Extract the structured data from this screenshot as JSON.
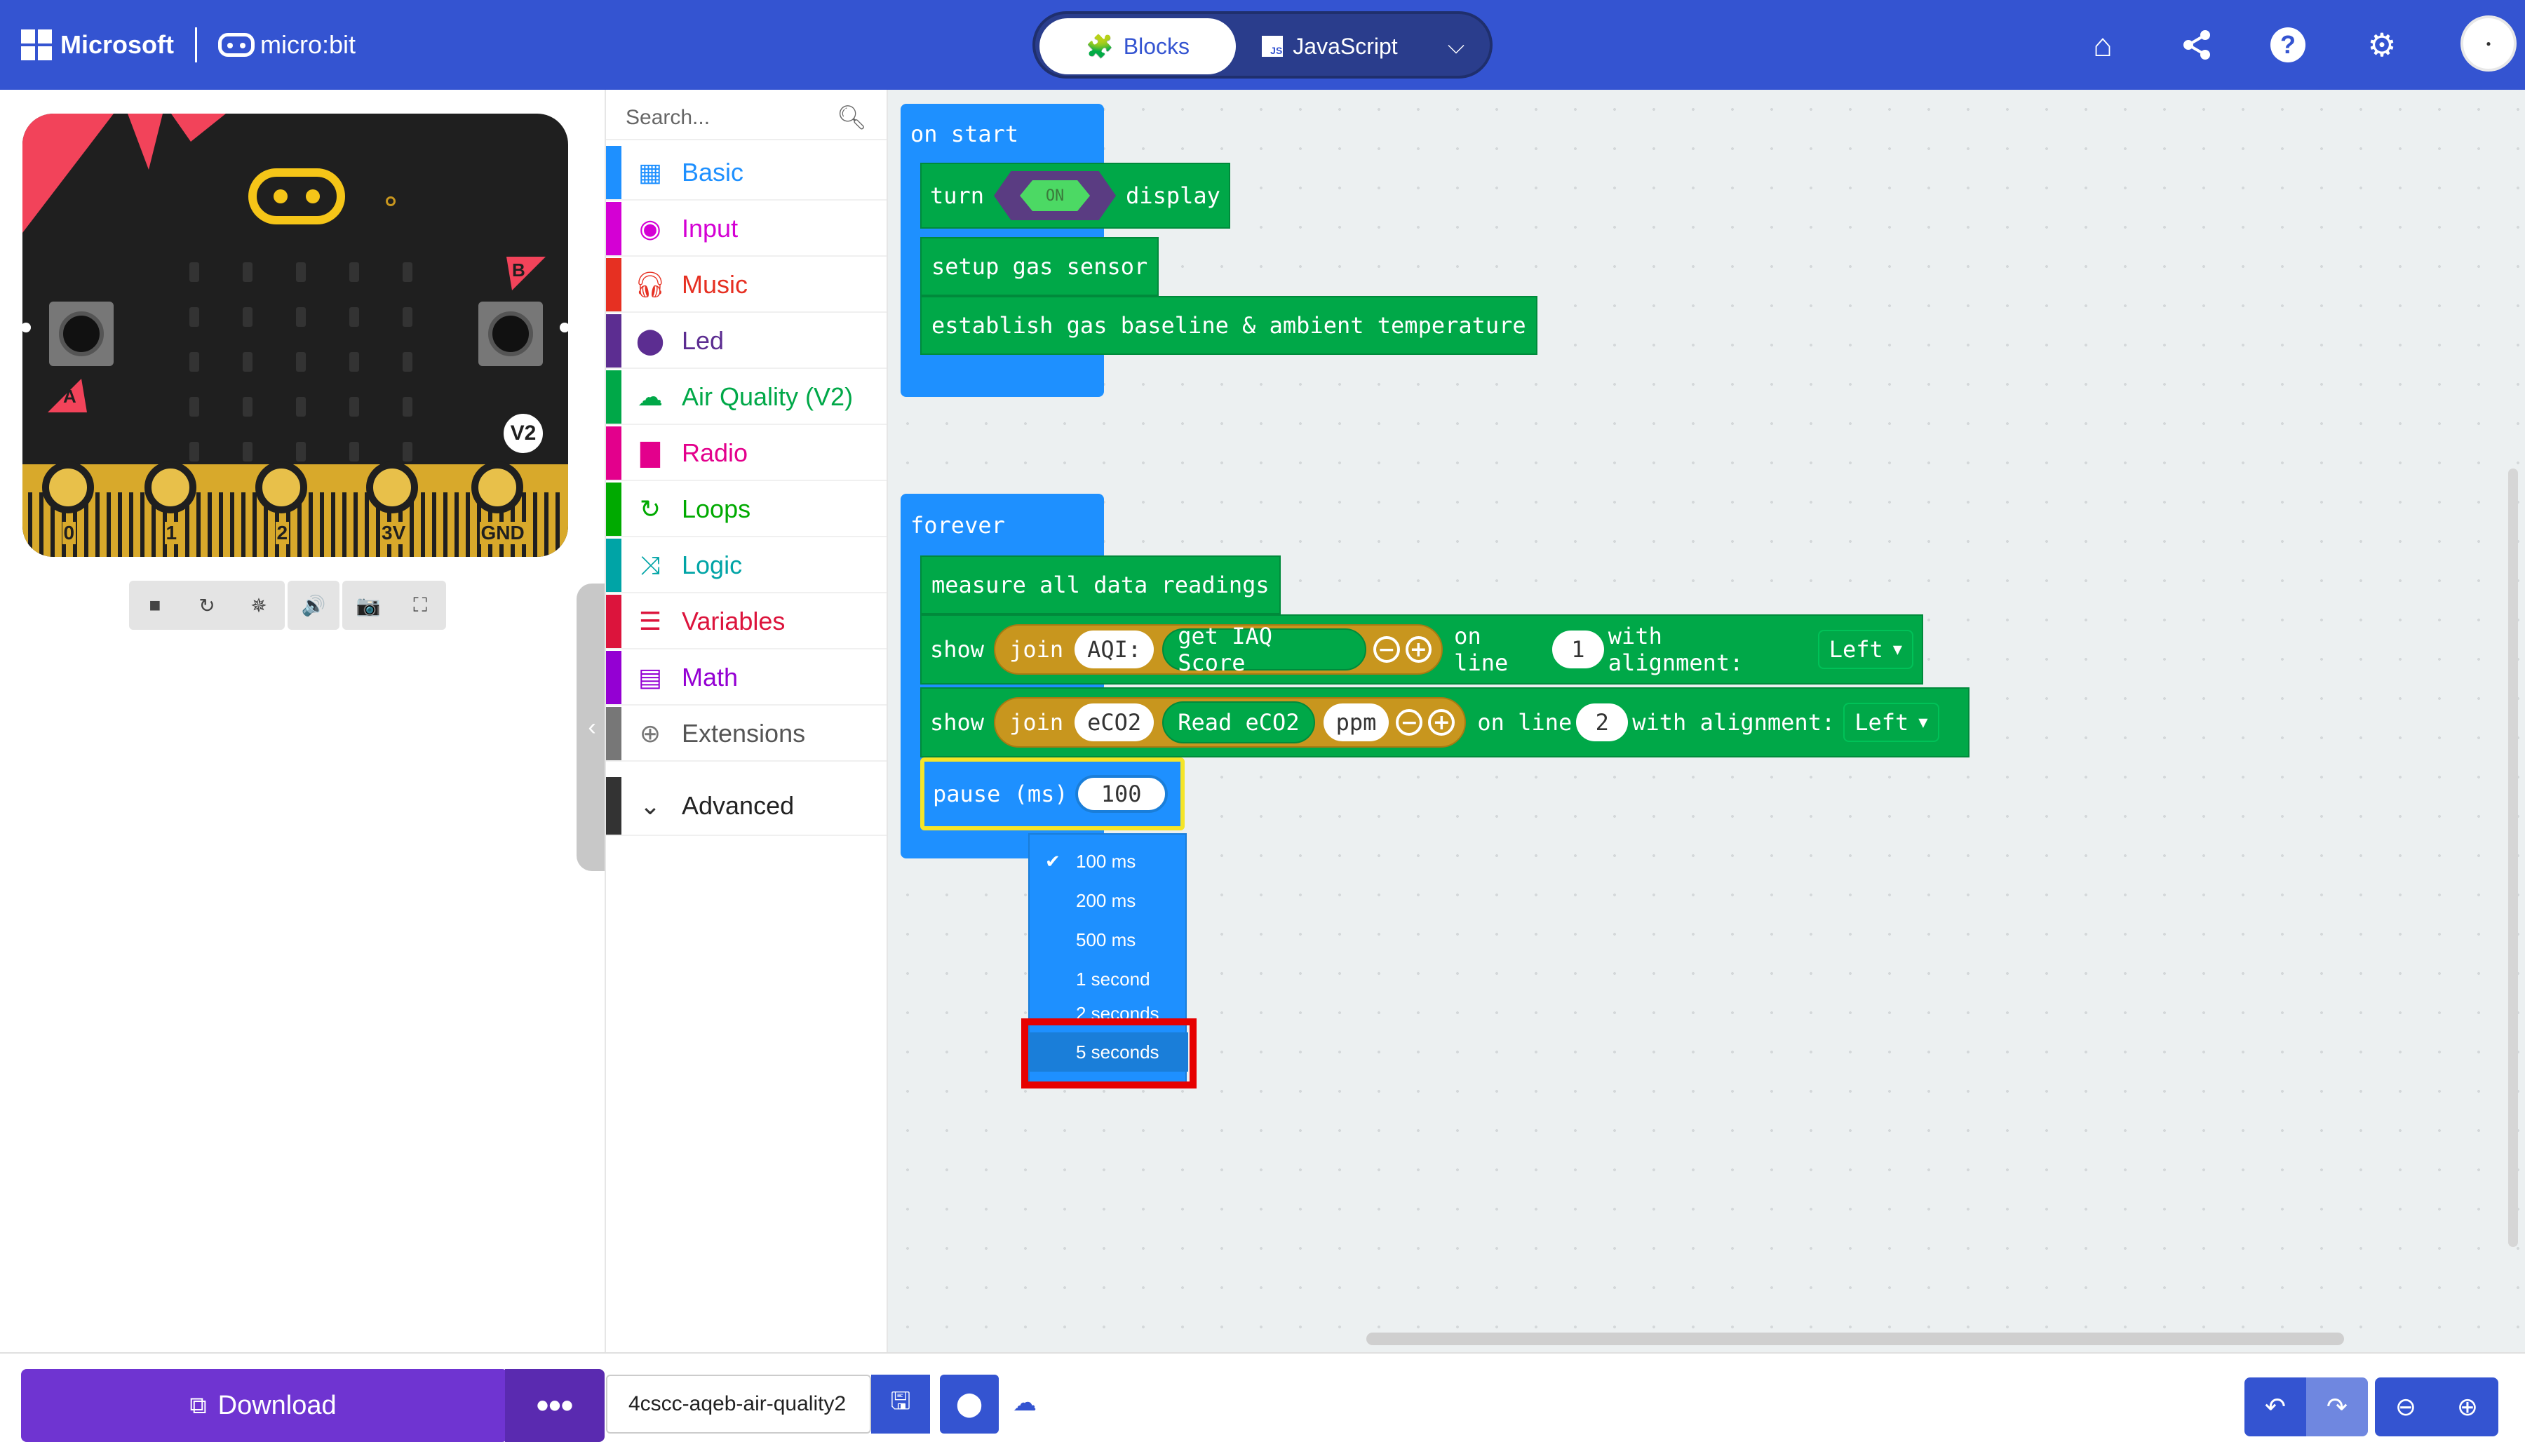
{
  "header": {
    "brand": "Microsoft",
    "product": "micro:bit",
    "tabs": [
      {
        "label": "Blocks",
        "active": true
      },
      {
        "label": "JavaScript",
        "active": false
      }
    ],
    "js_icon_text": "JS",
    "icons": [
      "home-icon",
      "share-icon",
      "help-icon",
      "settings-icon",
      "avatar"
    ]
  },
  "simulator": {
    "pins": [
      "0",
      "1",
      "2",
      "3V",
      "GND"
    ],
    "button_a": "A",
    "button_b": "B",
    "version": "V2",
    "controls": [
      "stop-icon",
      "restart-icon",
      "debug-icon",
      "sound-icon",
      "screenshot-icon",
      "fullscreen-icon"
    ]
  },
  "toolbox": {
    "search_placeholder": "Search...",
    "categories": [
      {
        "label": "Basic",
        "color": "#1e90ff"
      },
      {
        "label": "Input",
        "color": "#d400d4"
      },
      {
        "label": "Music",
        "color": "#e63022"
      },
      {
        "label": "Led",
        "color": "#5c2d91"
      },
      {
        "label": "Air Quality (V2)",
        "color": "#00a848"
      },
      {
        "label": "Radio",
        "color": "#e3008c"
      },
      {
        "label": "Loops",
        "color": "#00aa00"
      },
      {
        "label": "Logic",
        "color": "#00a4a6"
      },
      {
        "label": "Variables",
        "color": "#dc143c"
      },
      {
        "label": "Math",
        "color": "#9400d3"
      },
      {
        "label": "Extensions",
        "color": "#777777"
      },
      {
        "label": "Advanced",
        "color": "#333333"
      }
    ]
  },
  "blocks": {
    "on_start": {
      "label": "on start",
      "turn": "turn",
      "on": "ON",
      "display": "display",
      "setup": "setup gas sensor",
      "baseline": "establish gas baseline & ambient temperature"
    },
    "forever": {
      "label": "forever",
      "measure": "measure all data readings",
      "show1": {
        "show": "show",
        "join": "join",
        "text": "AQI: ",
        "value": "get IAQ Score",
        "on_line": "on line",
        "line": "1",
        "align_label": "with alignment:",
        "align": "Left"
      },
      "show2": {
        "show": "show",
        "join": "join",
        "text": "eCO2",
        "value": "Read eCO2",
        "unit": "ppm",
        "on_line": "on line",
        "line": "2",
        "align_label": "with alignment:",
        "align": "Left"
      },
      "pause": {
        "label": "pause (ms)",
        "value": "100"
      }
    }
  },
  "dropdown": {
    "items": [
      "100 ms",
      "200 ms",
      "500 ms",
      "1 second",
      "2 seconds",
      "5 seconds"
    ],
    "checked": "100 ms",
    "highlighted": "5 seconds"
  },
  "footer": {
    "download": "Download",
    "more": "•••",
    "project_name": "4cscc-aqeb-air-quality2"
  }
}
